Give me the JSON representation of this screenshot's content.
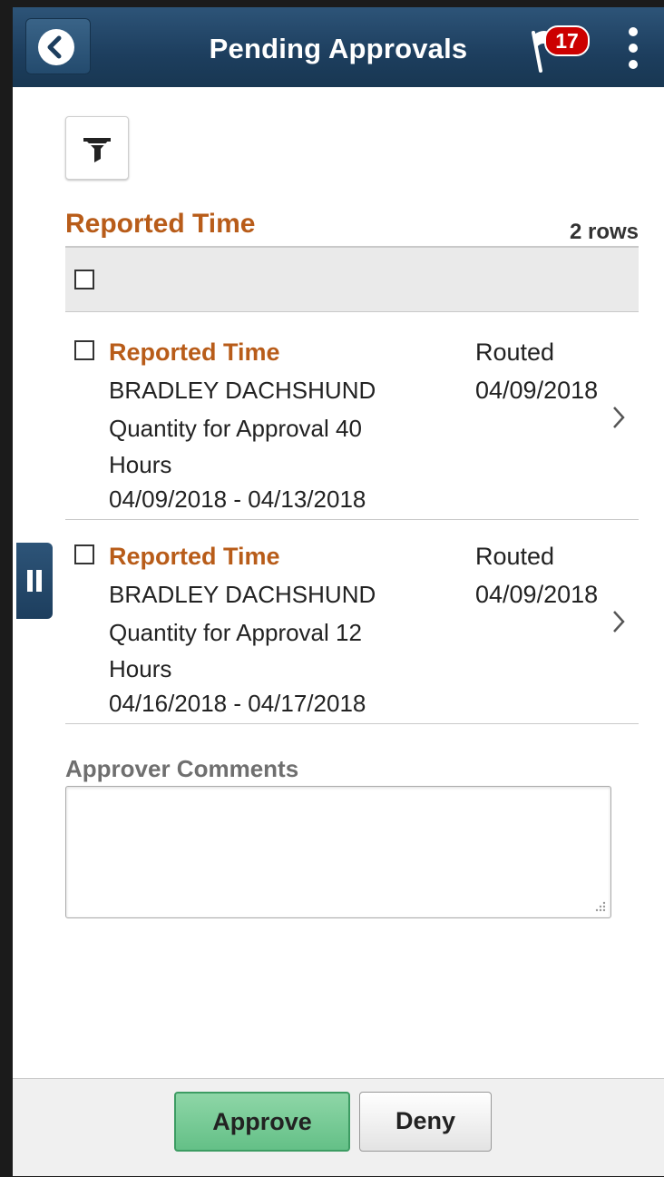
{
  "header": {
    "title": "Pending Approvals",
    "notification_count": "17"
  },
  "section": {
    "title": "Reported Time",
    "row_count": "2 rows"
  },
  "items": [
    {
      "title": "Reported Time",
      "name": "BRADLEY DACHSHUND",
      "quantity_line1": "Quantity for Approval 40",
      "quantity_line2": "Hours",
      "date_range": "04/09/2018 - 04/13/2018",
      "status": "Routed",
      "status_date": "04/09/2018"
    },
    {
      "title": "Reported Time",
      "name": "BRADLEY DACHSHUND",
      "quantity_line1": "Quantity for Approval 12",
      "quantity_line2": "Hours",
      "date_range": "04/16/2018 - 04/17/2018",
      "status": "Routed",
      "status_date": "04/09/2018"
    }
  ],
  "comments": {
    "label": "Approver Comments",
    "value": ""
  },
  "footer": {
    "approve_label": "Approve",
    "deny_label": "Deny"
  },
  "colors": {
    "header_bg": "#1d3e5e",
    "accent_orange": "#b85c19",
    "approve_green": "#64c087",
    "badge_red": "#cc0000"
  },
  "icons": {
    "back": "back-arrow-icon",
    "flag": "notification-flag-icon",
    "menu": "kebab-menu-icon",
    "filter": "filter-icon",
    "chevron": "chevron-right-icon",
    "side_tab": "pause-bars-icon"
  }
}
